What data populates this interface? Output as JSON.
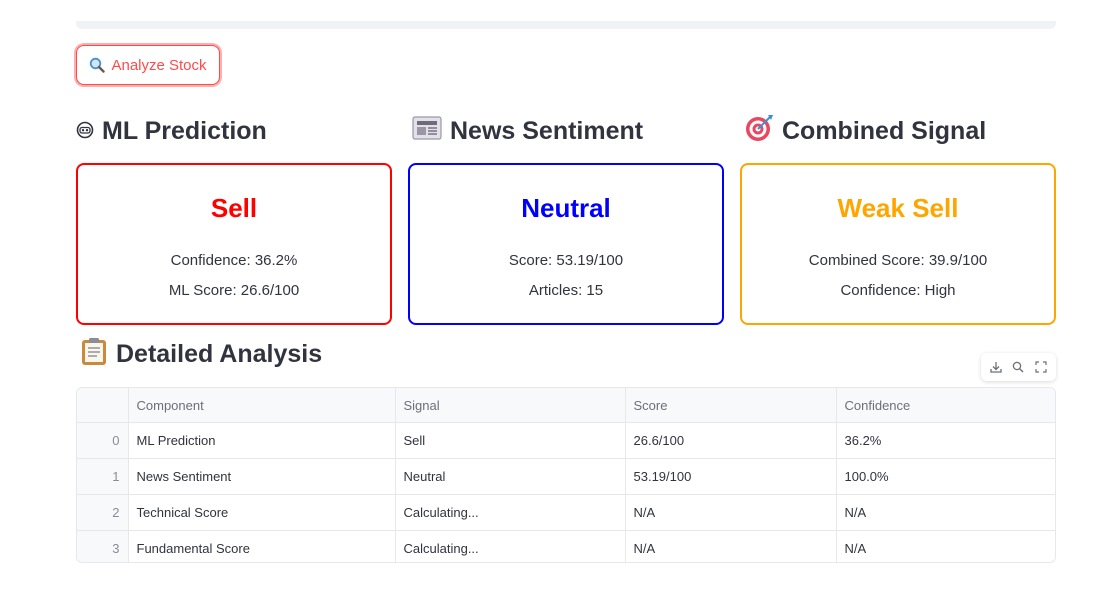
{
  "analyze_button": {
    "label": "Analyze Stock",
    "icon": "search-icon"
  },
  "sections": {
    "ml": {
      "title": "ML Prediction",
      "icon": "robot-icon"
    },
    "news": {
      "title": "News Sentiment",
      "icon": "newspaper-icon"
    },
    "combined": {
      "title": "Combined Signal",
      "icon": "target-icon"
    },
    "detailed": {
      "title": "Detailed Analysis",
      "icon": "clipboard-icon"
    }
  },
  "cards": {
    "ml": {
      "signal": "Sell",
      "line1": "Confidence: 36.2%",
      "line2": "ML Score: 26.6/100",
      "color": "#ff0000"
    },
    "news": {
      "signal": "Neutral",
      "line1": "Score: 53.19/100",
      "line2": "Articles: 15",
      "color": "#0000ff"
    },
    "combined": {
      "signal": "Weak Sell",
      "line1": "Combined Score: 39.9/100",
      "line2": "Confidence: High",
      "color": "#ffa500"
    }
  },
  "table": {
    "headers": [
      "",
      "Component",
      "Signal",
      "Score",
      "Confidence"
    ],
    "rows": [
      [
        "0",
        "ML Prediction",
        "Sell",
        "26.6/100",
        "36.2%"
      ],
      [
        "1",
        "News Sentiment",
        "Neutral",
        "53.19/100",
        "100.0%"
      ],
      [
        "2",
        "Technical Score",
        "Calculating...",
        "N/A",
        "N/A"
      ],
      [
        "3",
        "Fundamental Score",
        "Calculating...",
        "N/A",
        "N/A"
      ]
    ]
  },
  "toolbar": {
    "icons": [
      "download-icon",
      "search-icon",
      "fullscreen-icon"
    ]
  }
}
